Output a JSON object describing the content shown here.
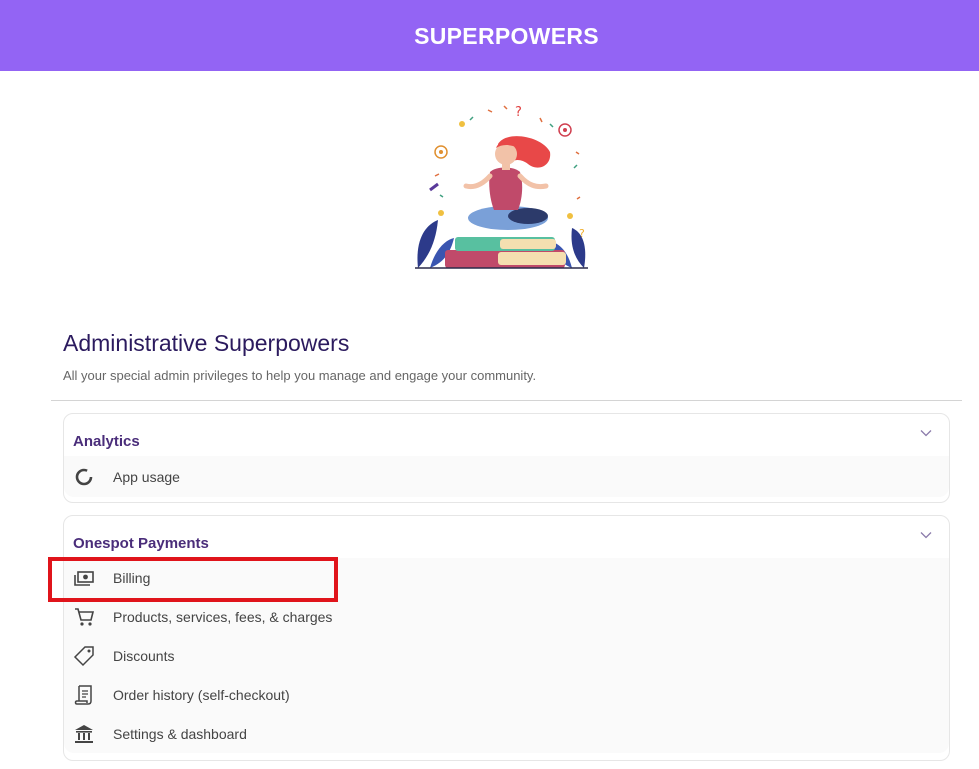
{
  "header": {
    "title": "SUPERPOWERS"
  },
  "intro": {
    "title": "Administrative Superpowers",
    "subtitle": "All your special admin privileges to help you manage and engage your community."
  },
  "sections": [
    {
      "title": "Analytics",
      "items": [
        {
          "label": "App usage",
          "icon": "donut-chart-icon"
        }
      ]
    },
    {
      "title": "Onespot Payments",
      "items": [
        {
          "label": "Billing",
          "icon": "cash-icon"
        },
        {
          "label": "Products, services, fees, & charges",
          "icon": "cart-icon"
        },
        {
          "label": "Discounts",
          "icon": "tag-icon"
        },
        {
          "label": "Order history (self-checkout)",
          "icon": "receipt-icon"
        },
        {
          "label": "Settings & dashboard",
          "icon": "bank-icon"
        }
      ]
    }
  ],
  "colors": {
    "header_bg": "#9364f4",
    "title": "#2b1a5e",
    "section_title": "#4a2d7a",
    "highlight": "#e0141b"
  }
}
